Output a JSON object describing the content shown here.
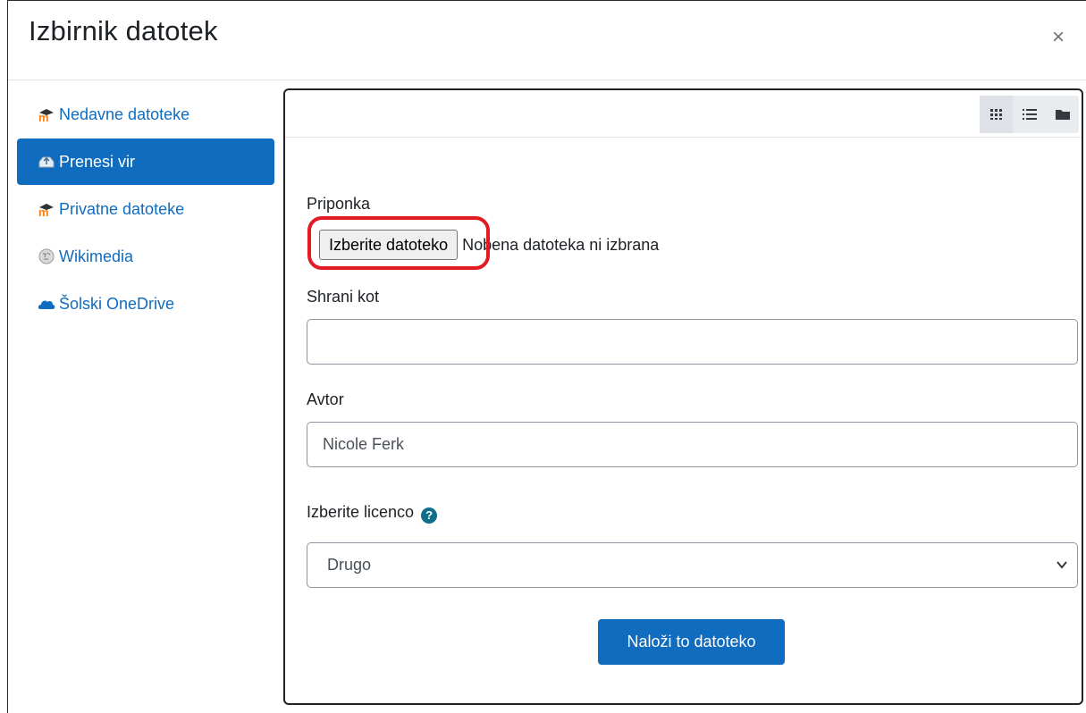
{
  "dialog": {
    "title": "Izbirnik datotek",
    "close_symbol": "×"
  },
  "sidebar": {
    "items": [
      {
        "label": "Nedavne datoteke",
        "icon": "moodle-icon",
        "active": false
      },
      {
        "label": "Prenesi vir",
        "icon": "upload-icon",
        "active": true
      },
      {
        "label": "Privatne datoteke",
        "icon": "moodle-icon",
        "active": false
      },
      {
        "label": "Wikimedia",
        "icon": "wikimedia-icon",
        "active": false
      },
      {
        "label": "Šolski OneDrive",
        "icon": "onedrive-icon",
        "active": false
      }
    ]
  },
  "viewbar": {
    "buttons": [
      "grid-view-icon",
      "list-view-icon",
      "folder-view-icon"
    ]
  },
  "form": {
    "attachment_label": "Priponka",
    "file_button_label": "Izberite datoteko",
    "file_status": "Nobena datoteka ni izbrana",
    "save_as_label": "Shrani kot",
    "save_as_value": "",
    "author_label": "Avtor",
    "author_value": "Nicole Ferk",
    "license_label": "Izberite licenco",
    "license_selected": "Drugo",
    "submit_label": "Naloži to datoteko"
  },
  "colors": {
    "accent": "#0f6cbf",
    "highlight": "#e21a22",
    "help": "#0f6f89"
  }
}
